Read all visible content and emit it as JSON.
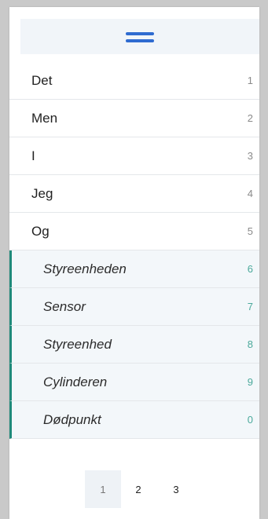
{
  "menu": {
    "icon": "hamburger-menu-icon",
    "accent_color": "#2f6bd0"
  },
  "list": {
    "items": [
      {
        "label": "Det",
        "number": "1"
      },
      {
        "label": "Men",
        "number": "2"
      },
      {
        "label": "I",
        "number": "3"
      },
      {
        "label": "Jeg",
        "number": "4"
      },
      {
        "label": "Og",
        "number": "5"
      }
    ],
    "subitems": [
      {
        "label": "Styreenheden",
        "number": "6"
      },
      {
        "label": "Sensor",
        "number": "7"
      },
      {
        "label": "Styreenhed",
        "number": "8"
      },
      {
        "label": "Cylinderen",
        "number": "9"
      },
      {
        "label": "Dødpunkt",
        "number": "0"
      }
    ],
    "subitem_accent_color": "#1f8a7a"
  },
  "pagination": {
    "pages": [
      "1",
      "2",
      "3"
    ],
    "current": "1"
  }
}
